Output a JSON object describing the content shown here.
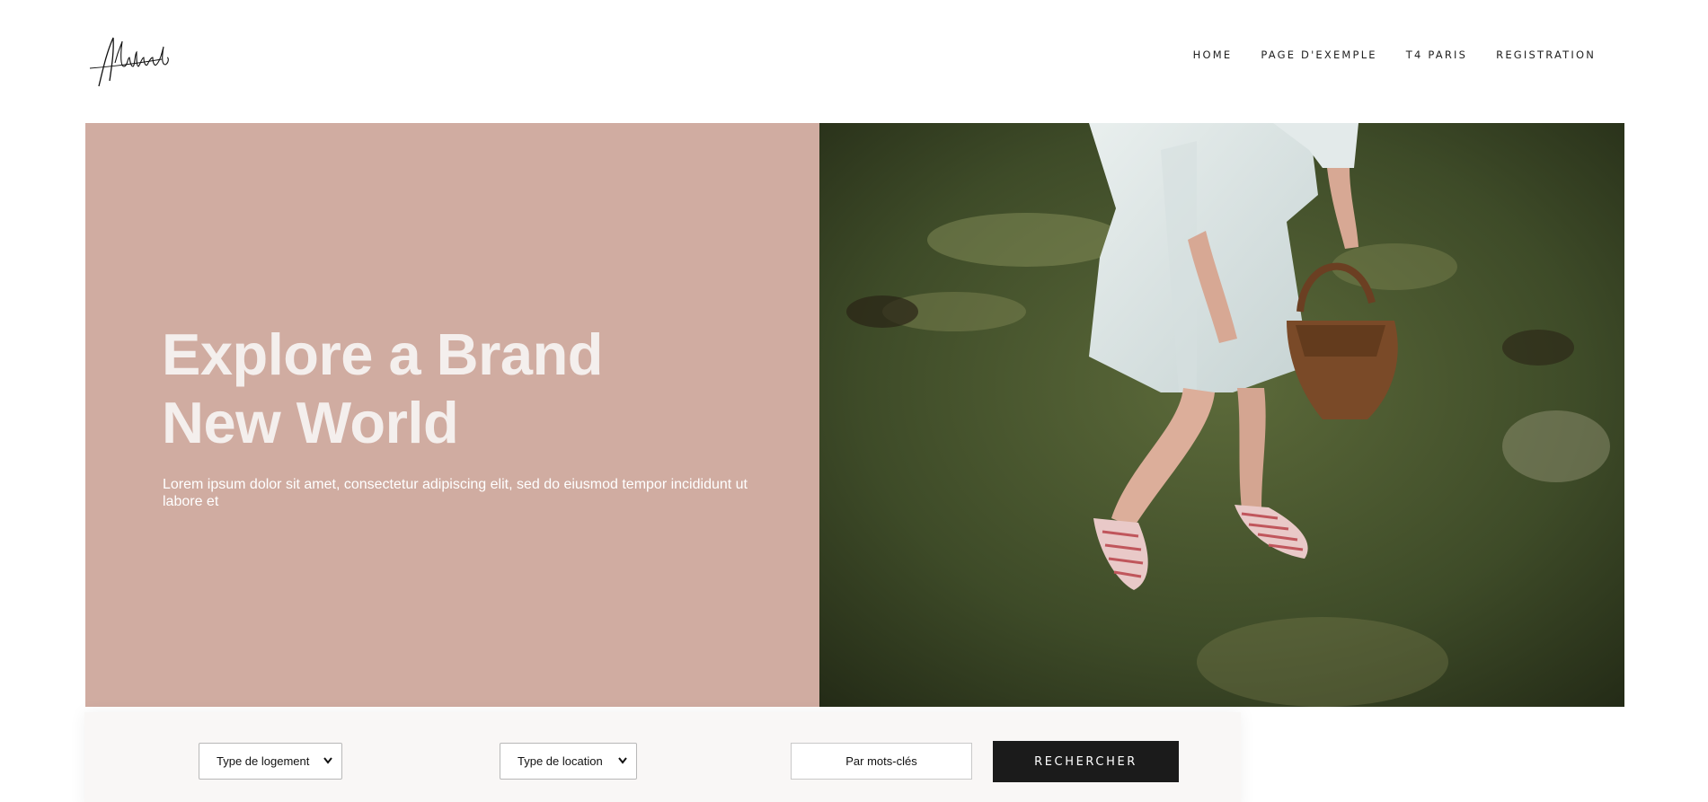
{
  "header": {
    "logo_text": "Aldibnb",
    "nav": [
      {
        "label": "HOME"
      },
      {
        "label": "PAGE D'EXEMPLE"
      },
      {
        "label": "T4 PARIS"
      },
      {
        "label": "REGISTRATION"
      }
    ]
  },
  "hero": {
    "title_line1": "Explore a Brand",
    "title_line2": "New World",
    "text": "Lorem ipsum dolor sit amet, consectetur adipiscing elit, sed do eiusmod tempor incididunt ut labore et",
    "background_color": "#d0aca1",
    "image_description_icon": "photo-woman-with-basket"
  },
  "search": {
    "logement_selected": "Type de logement",
    "location_selected": "Type de location",
    "keywords_placeholder": "Par mots-clés",
    "button_label": "RECHERCHER"
  },
  "colors": {
    "accent_dark": "#1b1b1b",
    "hero_pink": "#d0aca1",
    "searchbar_bg": "#f9f7f6"
  }
}
